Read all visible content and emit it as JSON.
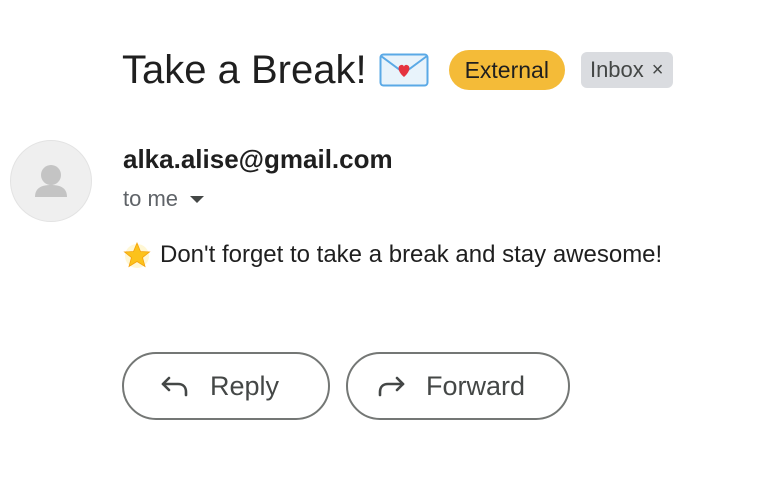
{
  "email": {
    "subject": "Take a Break!",
    "subject_icon": "love-letter-envelope-icon",
    "labels": {
      "external": "External",
      "inbox": "Inbox",
      "remove_symbol": "×"
    },
    "sender": "alka.alise@gmail.com",
    "recipient": "to me",
    "body_icon": "glowing-star-icon",
    "body_text": "Don't forget to take a break and stay awesome!"
  },
  "actions": {
    "reply_label": "Reply",
    "forward_label": "Forward"
  },
  "colors": {
    "external_badge": "#f4bb38",
    "inbox_badge": "#dadce0",
    "button_border": "#747775",
    "text_primary": "#1f1f1f",
    "text_secondary": "#5f6368"
  }
}
